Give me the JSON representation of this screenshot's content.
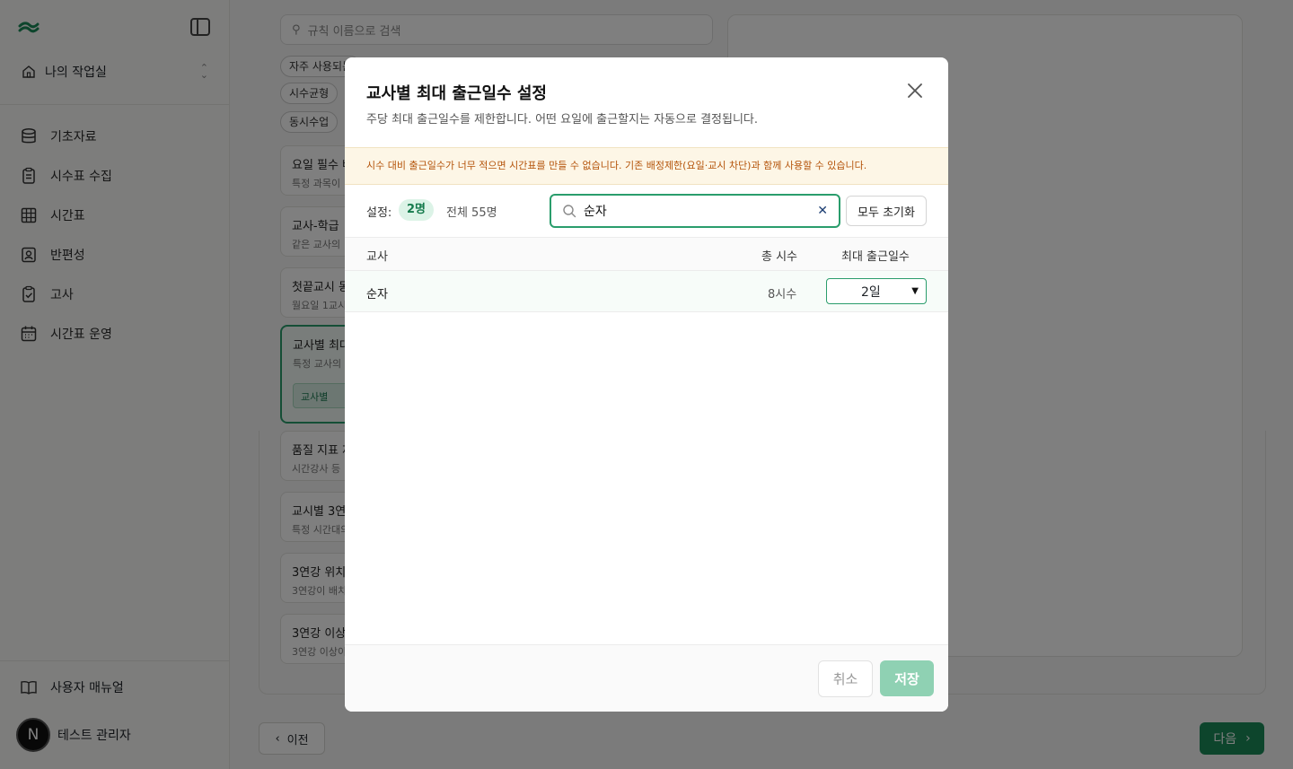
{
  "sidebar": {
    "workspace": "나의 작업실",
    "items": [
      {
        "label": "기초자료",
        "icon": "database-icon"
      },
      {
        "label": "시수표 수집",
        "icon": "clipboard-list-icon"
      },
      {
        "label": "시간표",
        "icon": "grid-icon"
      },
      {
        "label": "반편성",
        "icon": "contact-icon"
      },
      {
        "label": "고사",
        "icon": "clipboard-check-icon"
      },
      {
        "label": "시간표 운영",
        "icon": "calendar-icon"
      }
    ],
    "manual": "사용자 매뉴얼",
    "user_initial": "N",
    "user_name": "테스트 관리자"
  },
  "main": {
    "search_placeholder": "규칙 이름으로 검색",
    "chips": [
      "자주 사용되는",
      "시수균형",
      "동시수업"
    ],
    "rules": [
      {
        "title": "요일 필수 배",
        "desc": "특정 과목이"
      },
      {
        "title": "교사-학급",
        "desc": "같은 교사의"
      },
      {
        "title": "첫끝교시 동",
        "desc": "월요일 1교시"
      },
      {
        "title": "교사별 최대",
        "desc": "특정 교사의",
        "chip": "교사별"
      },
      {
        "title": "품질 지표 제",
        "desc": "시간강사 등"
      },
      {
        "title": "교시별 3연",
        "desc": "특정 시간대의"
      },
      {
        "title": "3연강 위치",
        "desc": "3연강이 배치"
      },
      {
        "title": "3연강 이상",
        "desc": "3연강 이상이"
      }
    ],
    "prev_label": "이전",
    "next_label": "다음"
  },
  "modal": {
    "title": "교사별 최대 출근일수 설정",
    "description": "주당 최대 출근일수를 제한합니다. 어떤 요일에 출근할지는 자동으로 결정됩니다.",
    "warning": "시수 대비 출근일수가 너무 적으면 시간표를 만들 수 없습니다. 기존 배정제한(요일·교시 차단)과 함께 사용할 수 있습니다.",
    "set_label": "설정:",
    "set_count": "2명",
    "total_label": "전체 55명",
    "search_value": "순자",
    "reset_label": "모두 초기화",
    "columns": {
      "teacher": "교사",
      "hours": "총 시수",
      "max_days": "최대 출근일수"
    },
    "rows": [
      {
        "teacher": "순자",
        "hours": "8시수",
        "max_days": "2일"
      }
    ],
    "cancel_label": "취소",
    "save_label": "저장"
  },
  "colors": {
    "accent": "#2a9d6c",
    "warning_text": "#b45309",
    "save_disabled": "#8fd1b3"
  }
}
